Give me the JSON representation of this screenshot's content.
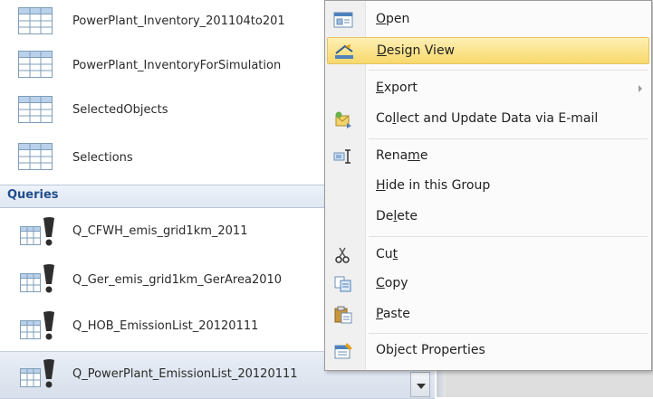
{
  "nav": {
    "tables": [
      {
        "label": "PowerPlant_Inventory_201104to201"
      },
      {
        "label": "PowerPlant_InventoryForSimulation"
      },
      {
        "label": "SelectedObjects"
      },
      {
        "label": "Selections"
      }
    ],
    "group_header": "Queries",
    "queries": [
      {
        "label": "Q_CFWH_emis_grid1km_2011"
      },
      {
        "label": "Q_Ger_emis_grid1km_GerArea2010"
      },
      {
        "label": "Q_HOB_EmissionList_20120111"
      },
      {
        "label": "Q_PowerPlant_EmissionList_20120111"
      }
    ]
  },
  "menu": {
    "open": {
      "pre": "",
      "key": "O",
      "post": "pen",
      "icon": "open-icon"
    },
    "design_view": {
      "pre": "",
      "key": "D",
      "post": "esign View",
      "icon": "design-view-icon"
    },
    "export": {
      "pre": "",
      "key": "E",
      "post": "xport",
      "icon": ""
    },
    "collect": {
      "pre": "Co",
      "key": "l",
      "post": "lect and Update Data via E-mail",
      "icon": "collect-data-icon"
    },
    "rename": {
      "pre": "Rena",
      "key": "m",
      "post": "e",
      "icon": "rename-icon"
    },
    "hide": {
      "pre": "",
      "key": "H",
      "post": "ide in this Group",
      "icon": ""
    },
    "delete": {
      "pre": "De",
      "key": "l",
      "post": "ete",
      "icon": ""
    },
    "cut": {
      "pre": "Cu",
      "key": "t",
      "post": "",
      "icon": "scissors-icon"
    },
    "copy": {
      "pre": "",
      "key": "C",
      "post": "opy",
      "icon": "copy-icon"
    },
    "paste": {
      "pre": "",
      "key": "P",
      "post": "aste",
      "icon": "paste-icon"
    },
    "properties": {
      "pre": "Ob",
      "key": "j",
      "post": "ect Properties",
      "icon": "properties-icon"
    }
  },
  "colors": {
    "highlight": "#f8d86b",
    "group_header_text": "#1f4e8c"
  }
}
